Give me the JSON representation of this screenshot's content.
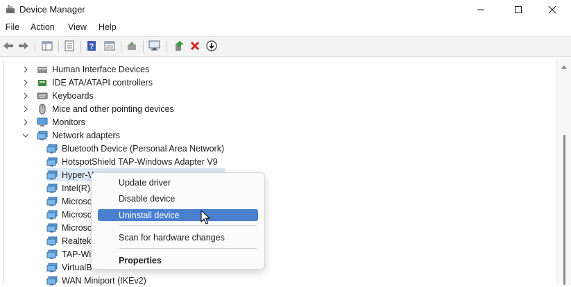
{
  "window": {
    "title": "Device Manager",
    "minimize_icon": "minimize-icon",
    "maximize_icon": "maximize-icon",
    "close_icon": "close-icon"
  },
  "menu": [
    "File",
    "Action",
    "View",
    "Help"
  ],
  "toolbar_icons": [
    "back-arrow-icon",
    "forward-arrow-icon",
    "console-tree-icon",
    "properties-icon",
    "help-icon",
    "view-icon",
    "update-driver-icon",
    "scan-hardware-icon",
    "enable-device-icon",
    "uninstall-icon",
    "download-icon"
  ],
  "tree": {
    "categories": [
      {
        "label": "Human Interface Devices",
        "expanded": false,
        "icon": "hid-icon"
      },
      {
        "label": "IDE ATA/ATAPI controllers",
        "expanded": false,
        "icon": "ide-controller-icon"
      },
      {
        "label": "Keyboards",
        "expanded": false,
        "icon": "keyboard-icon"
      },
      {
        "label": "Mice and other pointing devices",
        "expanded": false,
        "icon": "mouse-icon"
      },
      {
        "label": "Monitors",
        "expanded": false,
        "icon": "monitor-icon"
      },
      {
        "label": "Network adapters",
        "expanded": true,
        "icon": "network-adapter-icon"
      }
    ],
    "network_children": [
      "Bluetooth Device (Personal Area Network)",
      "HotspotShield TAP-Windows Adapter V9",
      "Hyper-V",
      "Intel(R)",
      "Microso",
      "Microso",
      "Microso",
      "Realtek",
      "TAP-Wi",
      "VirtualB",
      "WAN Miniport (IKEv2)"
    ]
  },
  "context_menu": {
    "items": [
      {
        "label": "Update driver"
      },
      {
        "label": "Disable device"
      },
      {
        "label": "Uninstall device",
        "highlighted": true
      },
      {
        "label": "Scan for hardware changes"
      },
      {
        "label": "Properties",
        "bold": true
      }
    ]
  },
  "colors": {
    "highlight": "#4a7fcf",
    "selection": "#dce9f7",
    "toolbar_bg": "#f3f3f3"
  }
}
